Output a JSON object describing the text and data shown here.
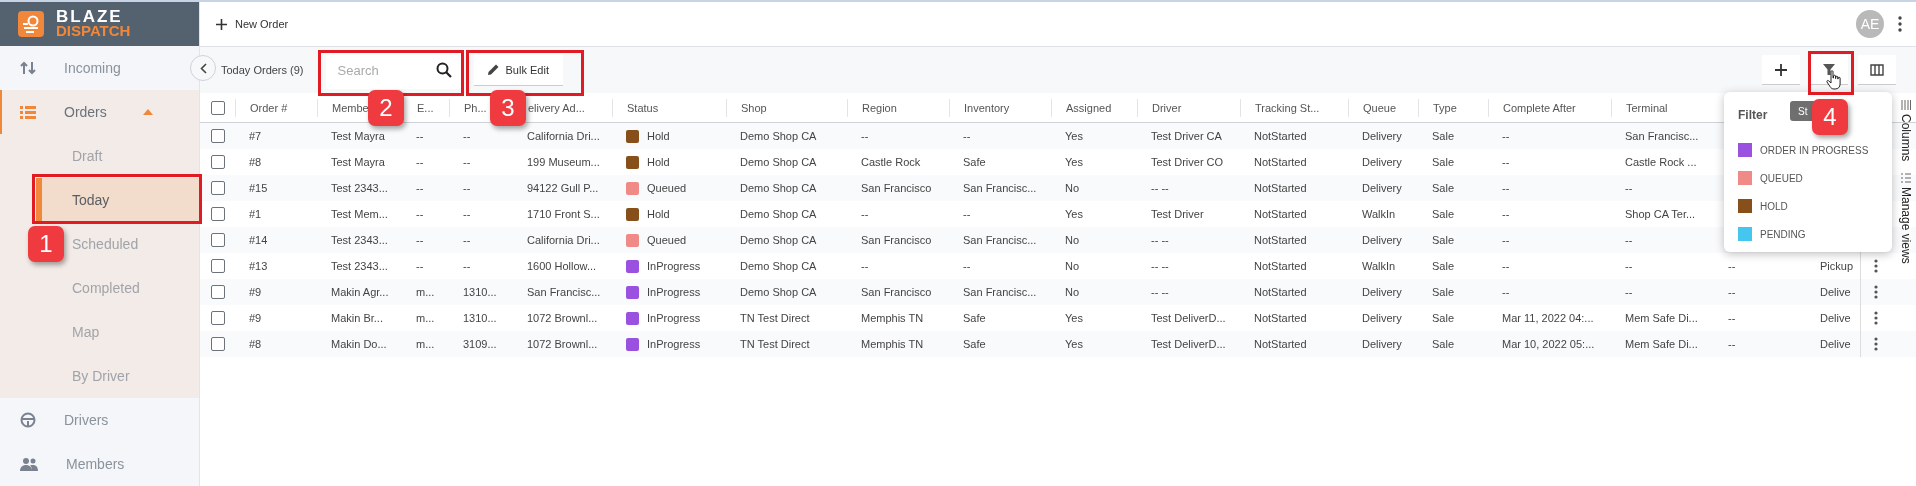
{
  "brand": {
    "line1": "BLAZE",
    "line2": "DISPATCH"
  },
  "nav": [
    {
      "label": "Incoming",
      "selected": false
    },
    {
      "label": "Orders",
      "selected": false,
      "expanded": true,
      "children": [
        {
          "label": "Draft",
          "selected": false
        },
        {
          "label": "Today",
          "selected": true
        },
        {
          "label": "Scheduled",
          "selected": false
        },
        {
          "label": "Completed",
          "selected": false
        },
        {
          "label": "Map",
          "selected": false
        },
        {
          "label": "By Driver",
          "selected": false
        }
      ]
    },
    {
      "label": "Drivers",
      "selected": false
    },
    {
      "label": "Members",
      "selected": false
    }
  ],
  "topbar": {
    "new_order": "New Order",
    "avatar": "AE"
  },
  "toolbar": {
    "title": "Today Orders (9)",
    "search": {
      "placeholder": "Search"
    },
    "bulk_edit": "Bulk Edit",
    "tooltip": "St"
  },
  "table": {
    "all_checked": false,
    "columns": [
      "Order #",
      "Membe",
      "E...",
      "Ph...",
      "elivery Ad...",
      "Status",
      "Shop",
      "Region",
      "Inventory",
      "Assigned",
      "Driver",
      "Tracking St...",
      "Queue",
      "Type",
      "Complete After",
      "Terminal"
    ],
    "rows": [
      {
        "checked": false,
        "color": "#87501a",
        "cells": [
          "#7",
          "Test Mayra",
          "--",
          "--",
          "California Dri...",
          "Hold",
          "Demo Shop CA",
          "--",
          "--",
          "Yes",
          "Test Driver CA",
          "NotStarted",
          "Delivery",
          "Sale",
          "--",
          "San Francisc..."
        ]
      },
      {
        "checked": false,
        "color": "#87501a",
        "cells": [
          "#8",
          "Test Mayra",
          "--",
          "--",
          "199 Museum...",
          "Hold",
          "Demo Shop CA",
          "Castle Rock",
          "Safe",
          "Yes",
          "Test Driver CO",
          "NotStarted",
          "Delivery",
          "Sale",
          "--",
          "Castle Rock ..."
        ]
      },
      {
        "checked": false,
        "color": "#f08a86",
        "cells": [
          "#15",
          "Test 2343...",
          "--",
          "--",
          "94122 Gull P...",
          "Queued",
          "Demo Shop CA",
          "San Francisco",
          "San Francisc...",
          "No",
          "-- --",
          "NotStarted",
          "Delivery",
          "Sale",
          "--",
          "--"
        ]
      },
      {
        "checked": false,
        "color": "#87501a",
        "cells": [
          "#1",
          "Test Mem...",
          "--",
          "--",
          "1710 Front S...",
          "Hold",
          "Demo Shop CA",
          "--",
          "--",
          "Yes",
          "Test Driver",
          "NotStarted",
          "WalkIn",
          "Sale",
          "--",
          "Shop CA Ter..."
        ]
      },
      {
        "checked": false,
        "color": "#f08a86",
        "cells": [
          "#14",
          "Test 2343...",
          "--",
          "--",
          "California Dri...",
          "Queued",
          "Demo Shop CA",
          "San Francisco",
          "San Francisc...",
          "No",
          "-- --",
          "NotStarted",
          "Delivery",
          "Sale",
          "--",
          "--"
        ]
      },
      {
        "checked": false,
        "color": "#9b51e0",
        "cells": [
          "#13",
          "Test 2343...",
          "--",
          "--",
          "1600 Hollow...",
          "InProgress",
          "Demo Shop CA",
          "--",
          "--",
          "No",
          "-- --",
          "NotStarted",
          "WalkIn",
          "Sale",
          "--",
          "--",
          "--",
          "Pickup"
        ]
      },
      {
        "checked": false,
        "color": "#9b51e0",
        "cells": [
          "#9",
          "Makin Agr...",
          "m...",
          "1310...",
          "San Francisc...",
          "InProgress",
          "Demo Shop CA",
          "San Francisco",
          "San Francisc...",
          "No",
          "-- --",
          "NotStarted",
          "Delivery",
          "Sale",
          "--",
          "--",
          "--",
          "Delive"
        ]
      },
      {
        "checked": false,
        "color": "#9b51e0",
        "cells": [
          "#9",
          "Makin Br...",
          "m...",
          "1310...",
          "1072 Brownl...",
          "InProgress",
          "TN Test Direct",
          "Memphis TN",
          "Safe",
          "Yes",
          "Test DeliverD...",
          "NotStarted",
          "Delivery",
          "Sale",
          "Mar 11, 2022 04:...",
          "Mem Safe Di...",
          "--",
          "Delive"
        ]
      },
      {
        "checked": false,
        "color": "#9b51e0",
        "cells": [
          "#8",
          "Makin Do...",
          "m...",
          "3109...",
          "1072 Brownl...",
          "InProgress",
          "TN Test Direct",
          "Memphis TN",
          "Safe",
          "Yes",
          "Test DeliverD...",
          "NotStarted",
          "Delivery",
          "Sale",
          "Mar 10, 2022 05:...",
          "Mem Safe Di...",
          "--",
          "Delive"
        ]
      }
    ]
  },
  "side_tabs": [
    "Columns",
    "Manage views"
  ],
  "filter_popup": {
    "title": "Filter",
    "items": [
      {
        "label": "ORDER IN PROGRESS",
        "color": "#9b51e0"
      },
      {
        "label": "QUEUED",
        "color": "#f08a86"
      },
      {
        "label": "HOLD",
        "color": "#87501a"
      },
      {
        "label": "PENDING",
        "color": "#45c6ef"
      }
    ]
  },
  "annotations": [
    {
      "label": "1"
    },
    {
      "label": "2"
    },
    {
      "label": "3"
    },
    {
      "label": "4"
    }
  ]
}
